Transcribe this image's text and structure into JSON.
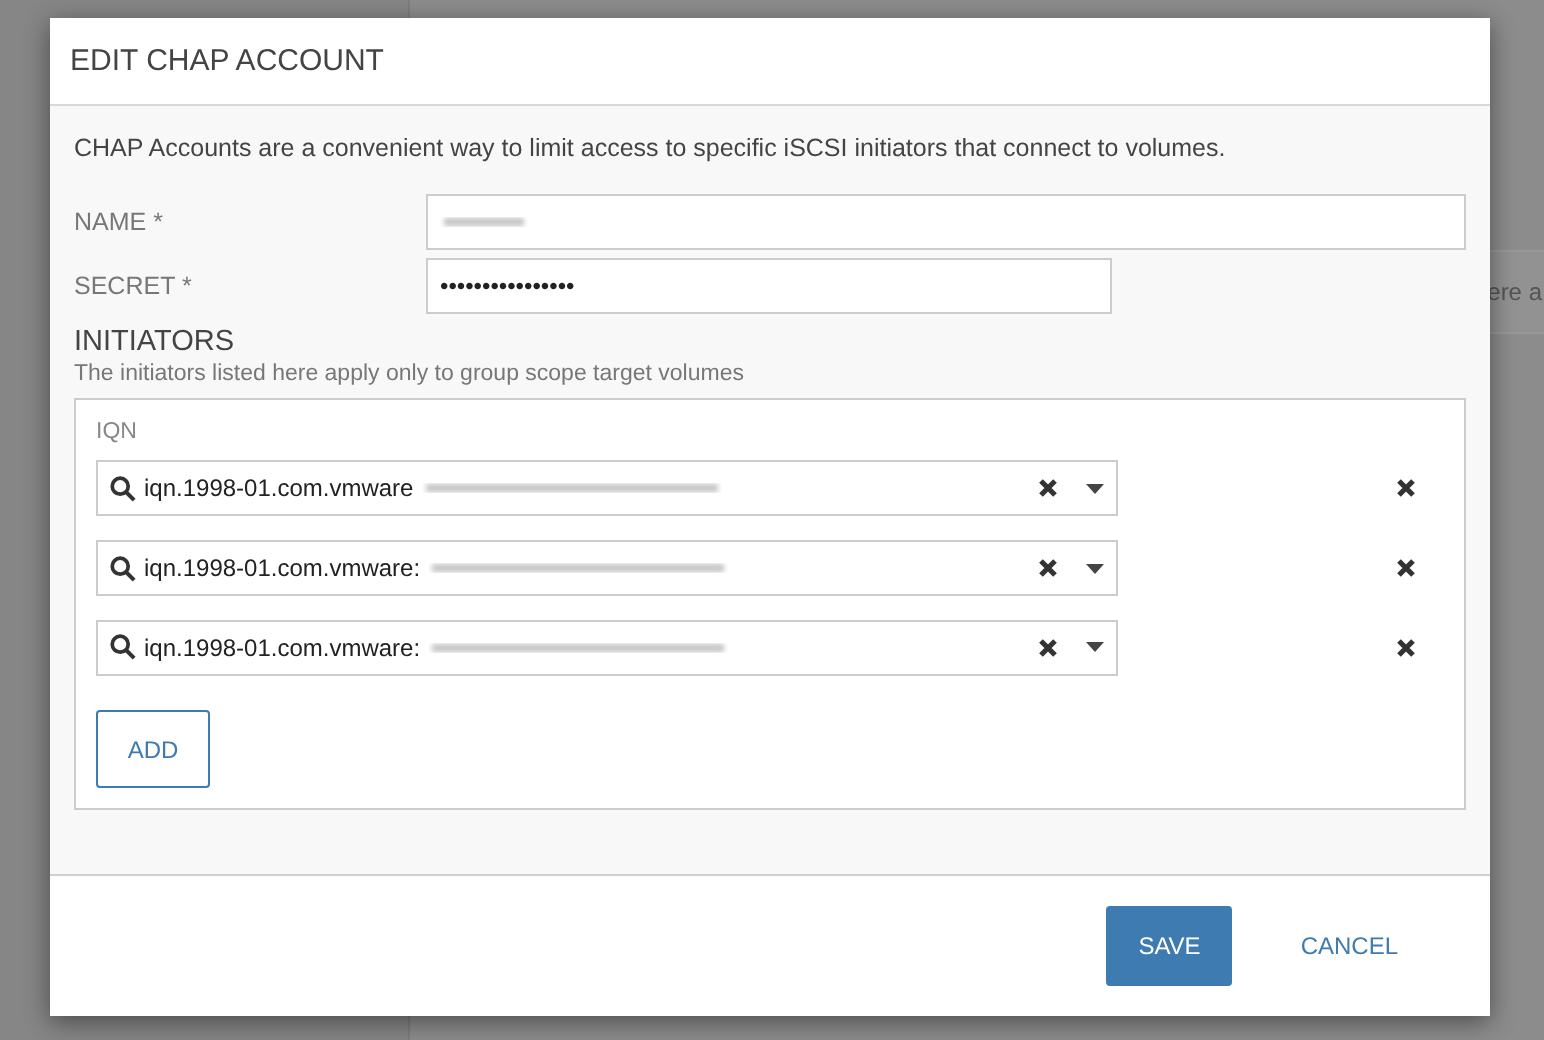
{
  "background": {
    "text": "ere a"
  },
  "dialog": {
    "title": "EDIT CHAP ACCOUNT",
    "description": "CHAP Accounts are a convenient way to limit access to specific iSCSI initiators that connect to volumes.",
    "fields": [
      {
        "label": "NAME *",
        "kind": "text",
        "redacted": true
      },
      {
        "label": "SECRET *",
        "kind": "password",
        "value": "••••••••••••••••"
      }
    ],
    "initiators": {
      "heading": "INITIATORS",
      "note": "The initiators listed here apply only to group scope target volumes",
      "column": "IQN",
      "rows": [
        {
          "value": "iqn.1998-01.com.vmware",
          "redacted": true
        },
        {
          "value": "iqn.1998-01.com.vmware:",
          "redacted": true
        },
        {
          "value": "iqn.1998-01.com.vmware:",
          "redacted": true
        }
      ],
      "add_button": "ADD"
    },
    "buttons": [
      {
        "label": "SAVE",
        "kind": "primary"
      },
      {
        "label": "CANCEL",
        "kind": "link"
      }
    ]
  }
}
